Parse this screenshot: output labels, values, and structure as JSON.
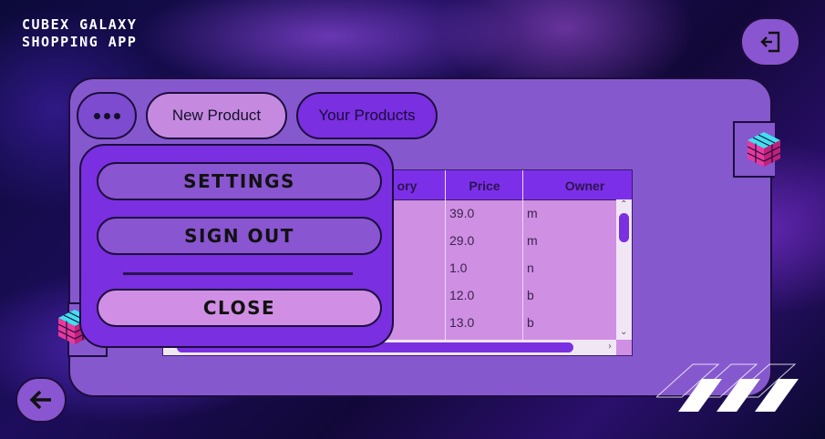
{
  "header": {
    "title_line1": "CUBEX GALAXY",
    "title_line2": "SHOPPING APP"
  },
  "nav": {
    "more_icon": "ellipsis-icon",
    "tabs": [
      {
        "label": "New Product",
        "selected": true
      },
      {
        "label": "Your Products",
        "selected": false
      }
    ]
  },
  "table": {
    "columns": [
      "ory",
      "Price",
      "Owner"
    ],
    "rows": [
      {
        "price": "39.0",
        "owner": "m"
      },
      {
        "price": "29.0",
        "owner": "m"
      },
      {
        "price": "1.0",
        "owner": "n"
      },
      {
        "price": "12.0",
        "owner": "b"
      },
      {
        "price": "13.0",
        "owner": "b"
      }
    ]
  },
  "menu": {
    "settings_label": "SETTINGS",
    "signout_label": "SIGN OUT",
    "close_label": "CLOSE"
  },
  "icons": {
    "exit": "exit-door-icon",
    "back": "arrow-left-icon",
    "cube": "rubiks-cube-icon"
  },
  "colors": {
    "panel": "#8658ce",
    "accent": "#7a2fe0",
    "highlight": "#c58ae0",
    "border": "#1c0d3d"
  }
}
